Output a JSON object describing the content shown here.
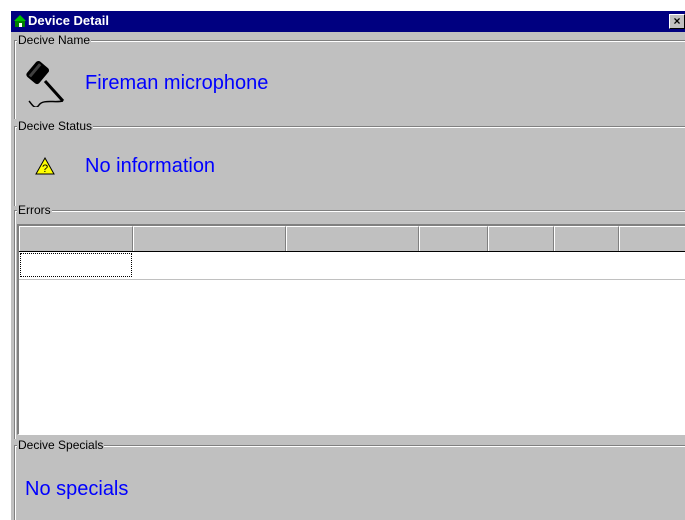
{
  "window": {
    "title": "Device Detail",
    "close_label": "×"
  },
  "device_name": {
    "group_label": "Decive Name",
    "value": "Fireman microphone",
    "icon": "microphone-icon"
  },
  "device_status": {
    "group_label": "Decive Status",
    "value": "No information",
    "icon": "warning-icon"
  },
  "errors": {
    "group_label": "Errors",
    "columns": [
      "",
      "",
      "",
      "",
      "",
      "",
      ""
    ],
    "rows": [
      [
        ""
      ]
    ]
  },
  "device_specials": {
    "group_label": "Decive Specials",
    "value": "No specials"
  }
}
